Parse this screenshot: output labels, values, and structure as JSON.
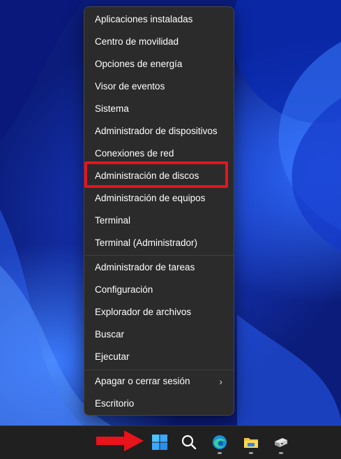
{
  "context_menu": {
    "items": [
      {
        "label": "Aplicaciones instaladas"
      },
      {
        "label": "Centro de movilidad"
      },
      {
        "label": "Opciones de energía"
      },
      {
        "label": "Visor de eventos"
      },
      {
        "label": "Sistema"
      },
      {
        "label": "Administrador de dispositivos"
      },
      {
        "label": "Conexiones de red"
      },
      {
        "label": "Administración de discos",
        "highlighted": true
      },
      {
        "label": "Administración de equipos"
      },
      {
        "label": "Terminal"
      },
      {
        "label": "Terminal (Administrador)"
      },
      {
        "label": "Administrador de tareas"
      },
      {
        "label": "Configuración"
      },
      {
        "label": "Explorador de archivos"
      },
      {
        "label": "Buscar"
      },
      {
        "label": "Ejecutar"
      },
      {
        "label": "Apagar o cerrar sesión",
        "submenu": true
      },
      {
        "label": "Escritorio"
      }
    ],
    "submenu_chevron": "›"
  },
  "taskbar": {
    "icons": [
      "windows-start-icon",
      "search-icon",
      "edge-browser-icon",
      "file-explorer-icon",
      "app-icon"
    ]
  },
  "annotations": {
    "highlight_color": "#e8131b",
    "arrow_color": "#e8131b"
  }
}
